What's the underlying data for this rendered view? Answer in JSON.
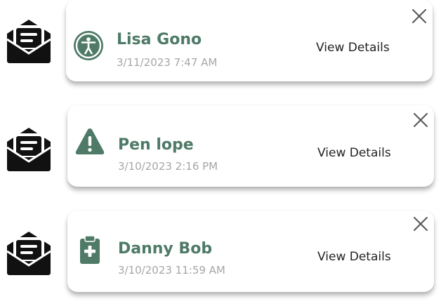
{
  "colors": {
    "accent": "#4e7a67",
    "timestamp": "#a6a6a6",
    "mail_icon": "#111111",
    "card_bg": "#ffffff"
  },
  "notifications": [
    {
      "icon": "accessibility-icon",
      "name": "Lisa Gono",
      "timestamp": "3/11/2023  7:47 AM",
      "details_label": "View Details"
    },
    {
      "icon": "warning-icon",
      "name": "Pen lope",
      "timestamp": "3/10/2023 2:16 PM",
      "details_label": "View Details"
    },
    {
      "icon": "clipboard-medical-icon",
      "name": "Danny Bob",
      "timestamp": "3/10/2023 11:59 AM",
      "details_label": "View Details"
    }
  ]
}
